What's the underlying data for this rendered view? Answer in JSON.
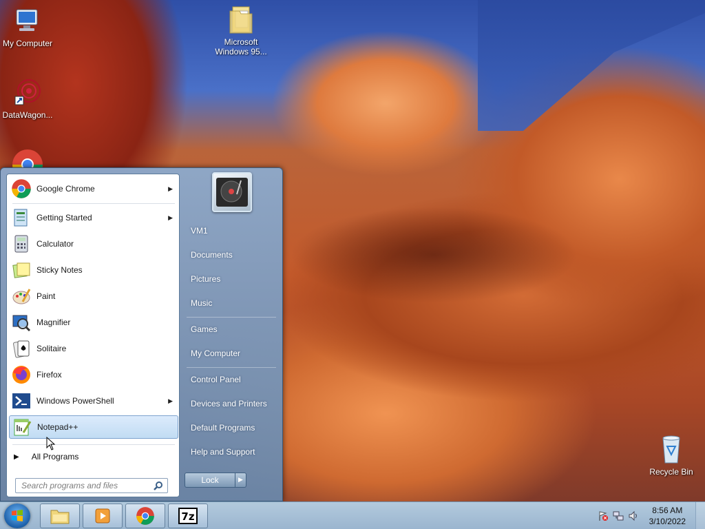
{
  "desktop": {
    "icons": [
      {
        "label": "My Computer",
        "icon": "computer-icon"
      },
      {
        "label": "DataWagon...",
        "icon": "datawagon-shortcut-icon"
      },
      {
        "label": "Microsoft\nWindows 95...",
        "icon": "folder-icon"
      },
      {
        "label": "Recycle Bin",
        "icon": "recycle-bin-icon"
      }
    ]
  },
  "start_menu": {
    "programs": [
      {
        "label": "Google Chrome",
        "icon": "chrome-icon",
        "has_submenu": true
      },
      {
        "label": "Getting Started",
        "icon": "getting-started-icon",
        "has_submenu": true
      },
      {
        "label": "Calculator",
        "icon": "calculator-icon",
        "has_submenu": false
      },
      {
        "label": "Sticky Notes",
        "icon": "sticky-notes-icon",
        "has_submenu": false
      },
      {
        "label": "Paint",
        "icon": "paint-icon",
        "has_submenu": false
      },
      {
        "label": "Magnifier",
        "icon": "magnifier-icon",
        "has_submenu": false
      },
      {
        "label": "Solitaire",
        "icon": "solitaire-icon",
        "has_submenu": false
      },
      {
        "label": "Firefox",
        "icon": "firefox-icon",
        "has_submenu": false
      },
      {
        "label": "Windows PowerShell",
        "icon": "powershell-icon",
        "has_submenu": true
      },
      {
        "label": "Notepad++",
        "icon": "notepadpp-icon",
        "has_submenu": false,
        "selected": true
      }
    ],
    "all_programs": "All Programs",
    "search_placeholder": "Search programs and files",
    "right_items": [
      "VM1",
      "Documents",
      "Pictures",
      "Music",
      "Games",
      "My Computer",
      "Control Panel",
      "Devices and Printers",
      "Default Programs",
      "Help and Support"
    ],
    "lock_label": "Lock"
  },
  "taskbar": {
    "pinned": [
      {
        "name": "explorer",
        "icon": "folder-icon"
      },
      {
        "name": "media-player",
        "icon": "media-player-icon"
      },
      {
        "name": "chrome",
        "icon": "chrome-icon"
      },
      {
        "name": "7zip",
        "icon": "7zip-icon"
      }
    ],
    "clock_time": "8:56 AM",
    "clock_date": "3/10/2022"
  },
  "colors": {
    "selection": "#c1dcf3",
    "menu_blue": "#8aa8c8",
    "taskbar": "#a8c0d8"
  }
}
